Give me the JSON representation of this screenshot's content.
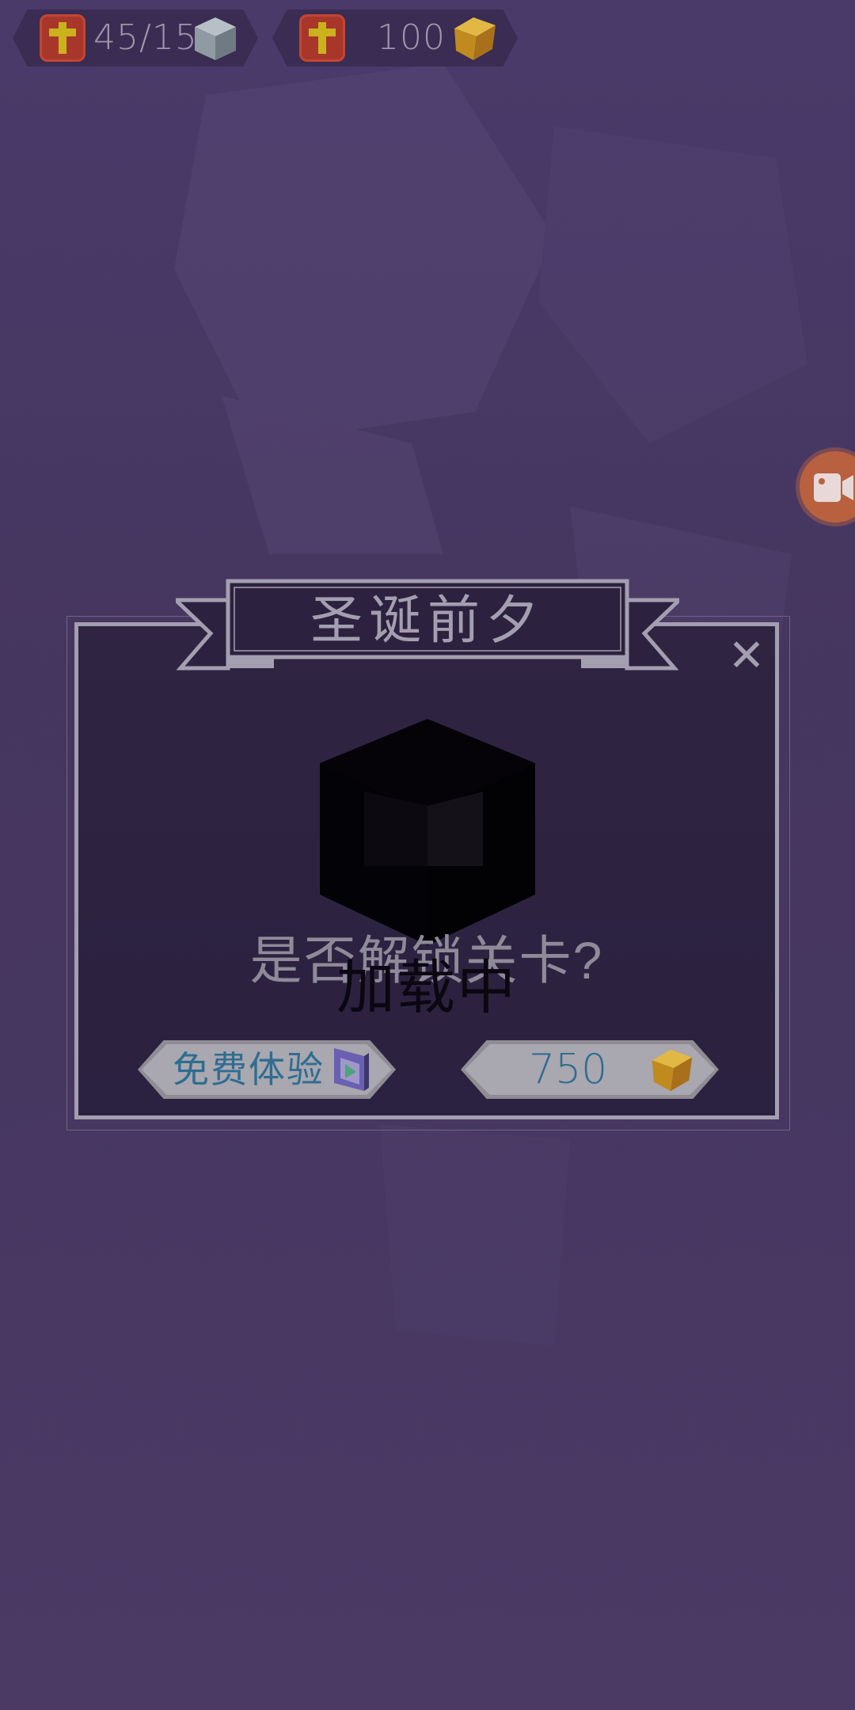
{
  "hud": {
    "level_progress": "45/15",
    "coins": "100"
  },
  "dialog": {
    "title": "圣诞前夕",
    "close_symbol": "✕",
    "question": "是否解锁关卡?",
    "loading": "加载中",
    "free_button_label": "免费体验",
    "price": "750"
  },
  "colors": {
    "background": "#463763",
    "dialog_bg": "#2d2341",
    "frame": "#a49fb0",
    "hud_button": "#a8362a",
    "button_text": "#2f6d90",
    "record_button": "#b9613f"
  },
  "icons": {
    "hud_add_left": "plus-icon",
    "hud_level_cube": "gray-cube-icon",
    "hud_add_right": "plus-icon",
    "hud_coin": "gold-cube-icon",
    "record": "video-camera-icon",
    "close": "close-icon",
    "free_button_icon": "video-ad-icon",
    "price_icon": "gold-cube-icon"
  }
}
